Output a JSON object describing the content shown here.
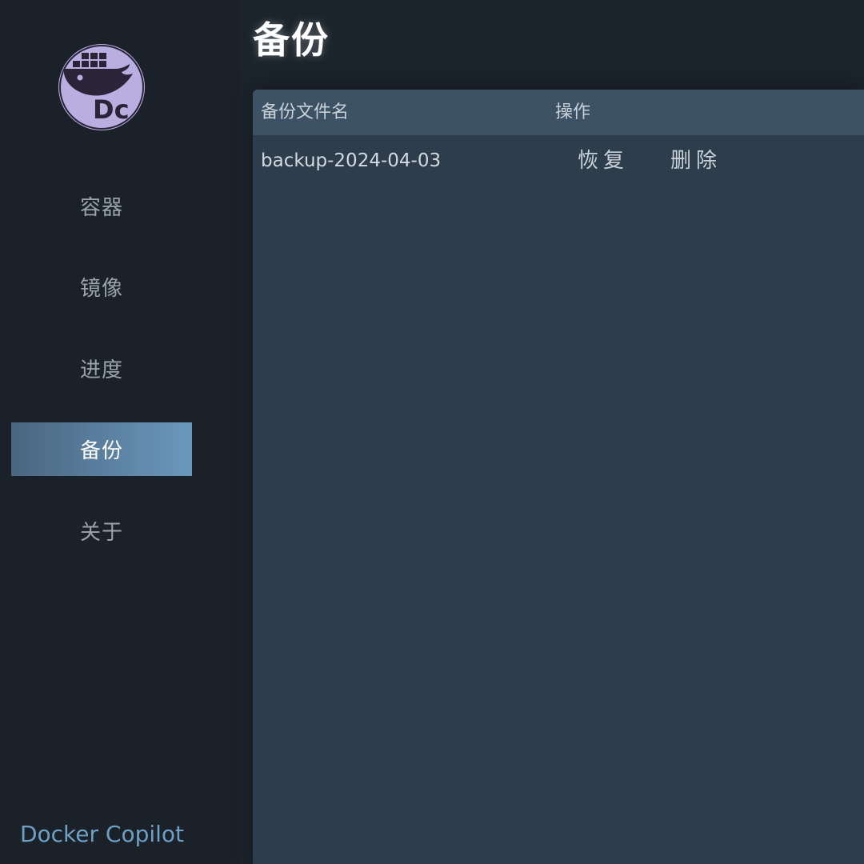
{
  "sidebar": {
    "logo_text": "Dc",
    "items": [
      {
        "label": "容器",
        "active": false
      },
      {
        "label": "镜像",
        "active": false
      },
      {
        "label": "进度",
        "active": false
      },
      {
        "label": "备份",
        "active": true
      },
      {
        "label": "关于",
        "active": false
      }
    ],
    "brand": "Docker Copilot"
  },
  "main": {
    "title": "备份",
    "table": {
      "columns": [
        "备份文件名",
        "操作"
      ],
      "rows": [
        {
          "filename": "backup-2024-04-03",
          "actions": [
            "恢复",
            "删除"
          ]
        }
      ]
    }
  },
  "colors": {
    "background": "#1b232b",
    "panel": "#2e3d4b",
    "table_header": "#3c5264",
    "active_nav_start": "#4a6680",
    "active_nav_end": "#6a98bd",
    "brand_text": "#6f9fc4",
    "logo_fill": "#b9aee0"
  }
}
